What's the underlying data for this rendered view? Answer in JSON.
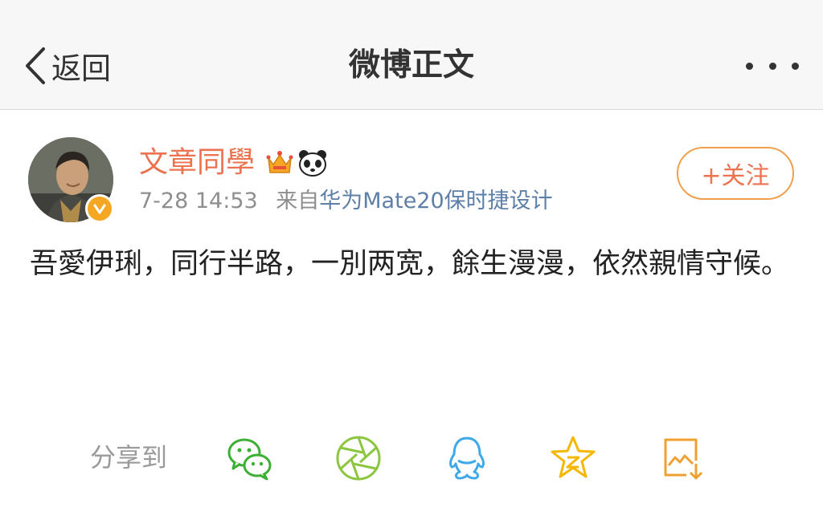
{
  "nav": {
    "back_label": "返回",
    "title": "微博正文"
  },
  "post": {
    "username": "文章同學",
    "time": "7-28 14:53",
    "source_prefix": "来自",
    "source": "华为Mate20保时捷设计",
    "follow_label": "+关注",
    "text": "吾愛伊琍，同行半路，一別两宽，餘生漫漫，依然親情守候。"
  },
  "share": {
    "label": "分享到",
    "targets": [
      "wechat-icon",
      "moments-icon",
      "qq-icon",
      "qzone-icon",
      "save-image-icon"
    ]
  },
  "colors": {
    "accent": "#eb7350",
    "link": "#5d7fa8",
    "wechat": "#3cb034",
    "moments": "#8cc63f",
    "qq": "#3fa9e8",
    "qzone": "#f5b800",
    "save": "#f0a030"
  }
}
